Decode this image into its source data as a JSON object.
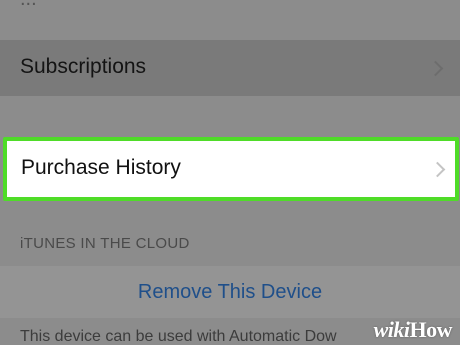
{
  "settings_list": {
    "top_partial_text": "...",
    "subscriptions_label": "Subscriptions",
    "purchase_history_label": "Purchase History",
    "section_header": "iTUNES IN THE CLOUD",
    "remove_device_label": "Remove This Device",
    "footer_text": "This device can be used with Automatic Dow"
  },
  "watermark": {
    "text_wiki": "wiki",
    "text_how": "How"
  },
  "colors": {
    "highlight_border": "#4fdc28",
    "link_blue": "#1f4f8a"
  },
  "icons": {
    "chevron": "chevron-right-icon"
  }
}
